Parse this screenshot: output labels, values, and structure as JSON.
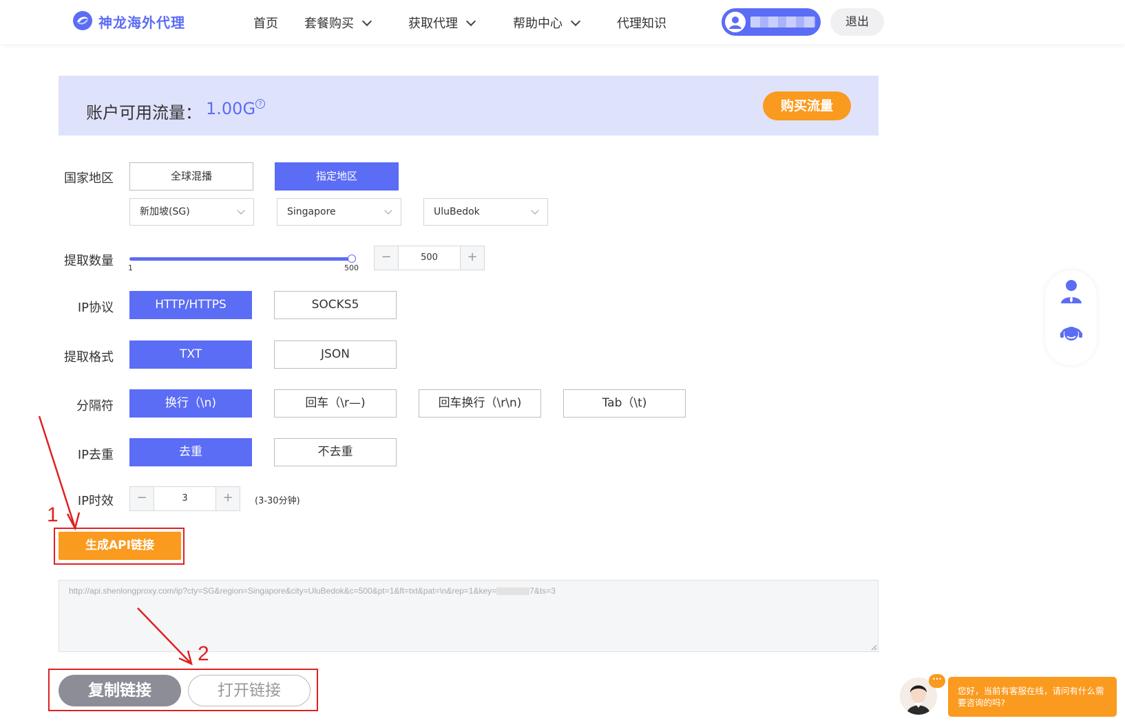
{
  "header": {
    "logo_text": "神龙海外代理",
    "nav": [
      {
        "label": "首页"
      },
      {
        "label": "套餐购买"
      },
      {
        "label": "获取代理"
      },
      {
        "label": "帮助中心"
      },
      {
        "label": "代理知识"
      }
    ],
    "logout_label": "退出",
    "brand_color": "#5b6cf5"
  },
  "banner": {
    "label": "账户可用流量：",
    "value": "1.00G",
    "info_icon": "?",
    "buy_label": "购买流量",
    "accent": "#fa9a1e"
  },
  "form": {
    "region_label": "国家地区",
    "region_options": [
      "全球混播",
      "指定地区"
    ],
    "region_selected": "指定地区",
    "country_select": "新加坡(SG)",
    "state_select": "Singapore",
    "city_select": "UluBedok",
    "count_label": "提取数量",
    "slider_min": "1",
    "slider_max": "500",
    "slider_value": 500,
    "count_value": "500",
    "protocol_label": "IP协议",
    "protocol_options": [
      "HTTP/HTTPS",
      "SOCKS5"
    ],
    "format_label": "提取格式",
    "format_options": [
      "TXT",
      "JSON"
    ],
    "separator_label": "分隔符",
    "separator_options": [
      "换行（\\n)",
      "回车（\\r—)",
      "回车换行（\\r\\n)",
      "Tab（\\t)"
    ],
    "dedupe_label": "IP去重",
    "dedupe_options": [
      "去重",
      "不去重"
    ],
    "ttl_label": "IP时效",
    "ttl_value": "3",
    "ttl_hint": "(3-30分钟)",
    "stepper_minus": "−",
    "stepper_plus": "+"
  },
  "actions": {
    "generate_label": "生成API链接",
    "api_url_prefix": "http://api.shenlongproxy.com/ip?cty=SG&region=Singapore&city=UluBedok&c=500&pt=1&ft=txt&pat=\\n&rep=1&key=",
    "api_url_suffix": "7&ts=3",
    "copy_label": "复制链接",
    "open_label": "打开链接",
    "annotation_1": "1",
    "annotation_2": "2"
  },
  "chat": {
    "bubble_text": "您好，当前有客服在线，请问有什么需要咨询的吗?",
    "dots": "···"
  }
}
